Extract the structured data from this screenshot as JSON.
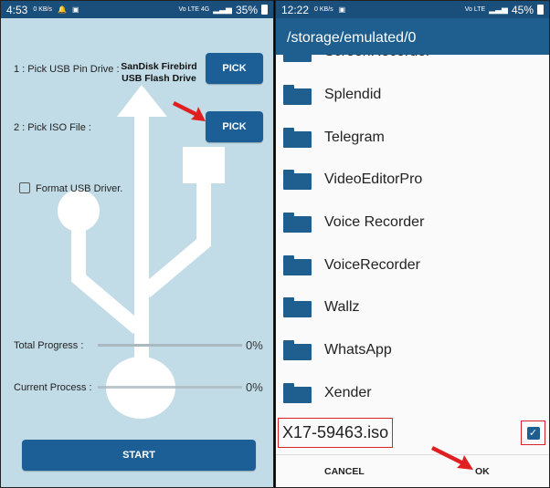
{
  "left": {
    "status": {
      "time": "4:53",
      "speed": "0 KB/s",
      "carrier": "Vo LTE 4G",
      "battery": "35%"
    },
    "pick_usb_label": "1 : Pick USB Pin Drive :",
    "drive_name": "SanDisk Firebird USB Flash Drive",
    "pick_button": "PICK",
    "pick_iso_label": "2 : Pick ISO File :",
    "pick_iso_button": "PICK",
    "format_label": "Format USB Driver.",
    "format_checked": false,
    "total_progress_label": "Total Progress :",
    "total_progress_value": "0%",
    "current_process_label": "Current Process :",
    "current_process_value": "0%",
    "start_button": "START",
    "colors": {
      "primary": "#1c5f97",
      "background": "#c1dce7",
      "annotation": "#e02020"
    }
  },
  "right": {
    "status": {
      "time": "12:22",
      "speed": "0 KB/s",
      "carrier": "Vo LTE",
      "battery": "45%"
    },
    "path": "/storage/emulated/0",
    "folders": [
      "ScreenRecorder",
      "Splendid",
      "Telegram",
      "VideoEditorPro",
      "Voice Recorder",
      "VoiceRecorder",
      "Wallz",
      "WhatsApp",
      "Xender"
    ],
    "selected_file": "X17-59463.iso",
    "selected_checked": true,
    "cancel_button": "CANCEL",
    "ok_button": "OK"
  }
}
